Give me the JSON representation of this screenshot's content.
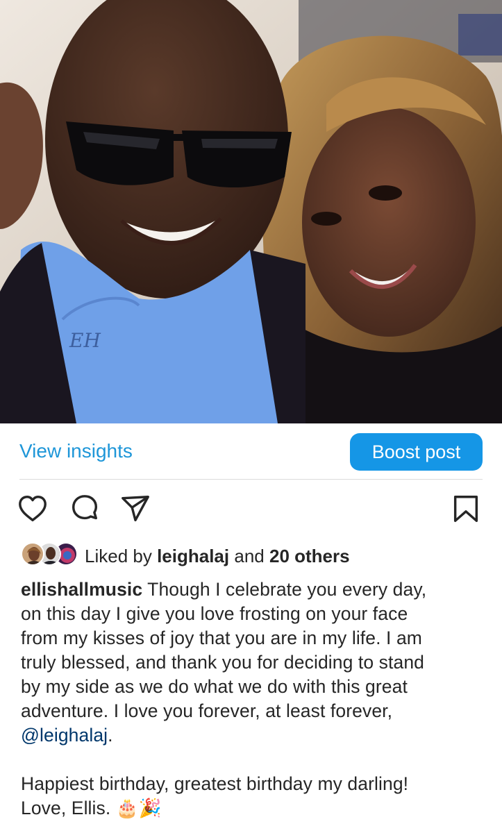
{
  "post": {
    "photo_alt": "selfie photo",
    "view_insights": "View insights",
    "boost_post": "Boost post"
  },
  "icons": {
    "like": "heart-icon",
    "comment": "comment-bubble-icon",
    "share": "paper-plane-icon",
    "save": "bookmark-icon"
  },
  "likes": {
    "prefix": "Liked by",
    "user": "leighalaj",
    "and": "and",
    "others": "20 others"
  },
  "caption": {
    "author": "ellishallmusic",
    "line1": " Though I celebrate you every day,",
    "line2": "on this day I give you love frosting on your face",
    "line3": "from my kisses of joy that you are in my life. I am",
    "line4": "truly blessed, and thank you for deciding to stand",
    "line5": "by my side as we do what we do with this great",
    "line6": "adventure. I love you forever, at least forever,",
    "mention": "@leighalaj",
    "mention_suffix": ".",
    "line8": "Happiest birthday, greatest birthday my darling!",
    "line9": "Love, Ellis. ",
    "emoji": "🎂🎉"
  },
  "colors": {
    "link_blue": "#1e96d8",
    "boost_bg": "#1596e6",
    "mention": "#00376b",
    "text": "#262626"
  }
}
